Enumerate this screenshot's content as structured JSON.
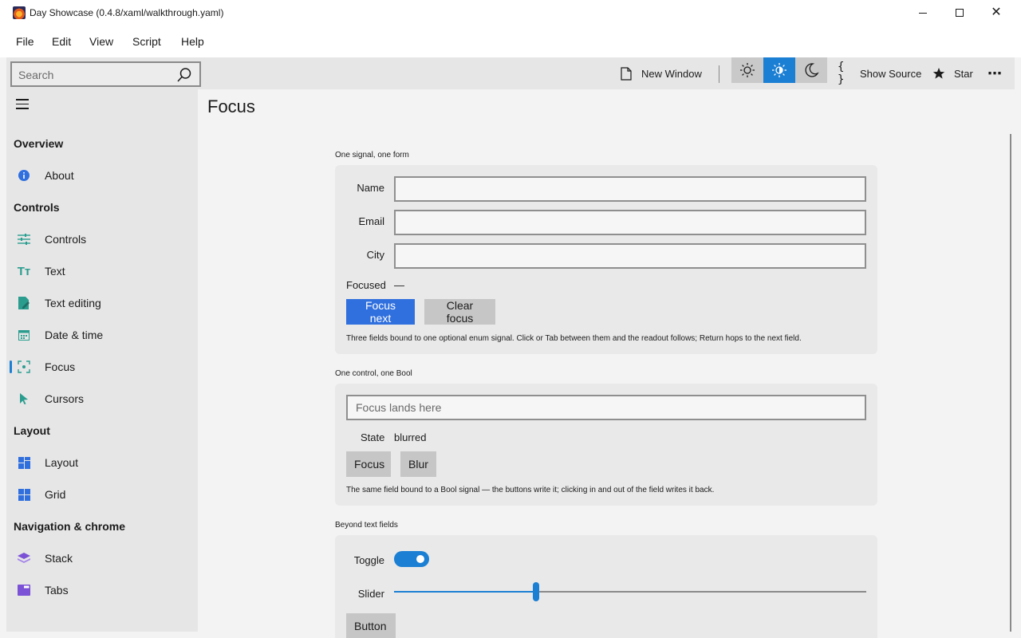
{
  "window": {
    "title": "Day Showcase (0.4.8/xaml/walkthrough.yaml)",
    "minimize_glyph": "—",
    "maximize_glyph": "☐",
    "close_glyph": "✕"
  },
  "menu": {
    "items": [
      "File",
      "Edit",
      "View",
      "Script",
      "Help"
    ]
  },
  "toolbar": {
    "search_placeholder": "Search",
    "new_window_label": "New Window",
    "show_source_label": "Show Source",
    "star_label": "Star",
    "more_glyph": "⋯",
    "theme_selected": "auto",
    "accent": "#1b7fd3"
  },
  "sidebar": {
    "sections": [
      {
        "title": "Overview",
        "items": [
          {
            "label": "About",
            "icon": "info-icon"
          }
        ]
      },
      {
        "title": "Controls",
        "items": [
          {
            "label": "Controls",
            "icon": "sliders-icon"
          },
          {
            "label": "Text",
            "icon": "text-icon"
          },
          {
            "label": "Text editing",
            "icon": "edit-icon"
          },
          {
            "label": "Date & time",
            "icon": "calendar-icon"
          },
          {
            "label": "Focus",
            "icon": "focus-icon",
            "active": true
          },
          {
            "label": "Cursors",
            "icon": "cursor-icon"
          }
        ]
      },
      {
        "title": "Layout",
        "items": [
          {
            "label": "Layout",
            "icon": "layout-icon"
          },
          {
            "label": "Grid",
            "icon": "grid-icon"
          }
        ]
      },
      {
        "title": "Navigation & chrome",
        "items": [
          {
            "label": "Stack",
            "icon": "stack-icon"
          },
          {
            "label": "Tabs",
            "icon": "tabs-icon"
          }
        ]
      }
    ]
  },
  "page": {
    "title": "Focus"
  },
  "form_section": {
    "label": "One signal, one form",
    "fields": [
      {
        "label": "Name",
        "value": ""
      },
      {
        "label": "Email",
        "value": ""
      },
      {
        "label": "City",
        "value": ""
      }
    ],
    "focused_label": "Focused",
    "focused_value": "—",
    "focus_next_label": "Focus next",
    "clear_focus_label": "Clear focus",
    "hint": "Three fields bound to one optional enum signal. Click or Tab between them and the readout follows; Return hops to the next field."
  },
  "bool_section": {
    "label": "One control, one Bool",
    "field_placeholder": "Focus lands here",
    "state_label": "State",
    "state_value": "blurred",
    "focus_label": "Focus",
    "blur_label": "Blur",
    "hint": "The same field bound to a Bool signal — the buttons write it; clicking in and out of the field writes it back."
  },
  "beyond_section": {
    "label": "Beyond text fields",
    "toggle_label": "Toggle",
    "toggle_on": true,
    "slider_label": "Slider",
    "slider_fraction": 0.3,
    "button_label": "Button"
  }
}
